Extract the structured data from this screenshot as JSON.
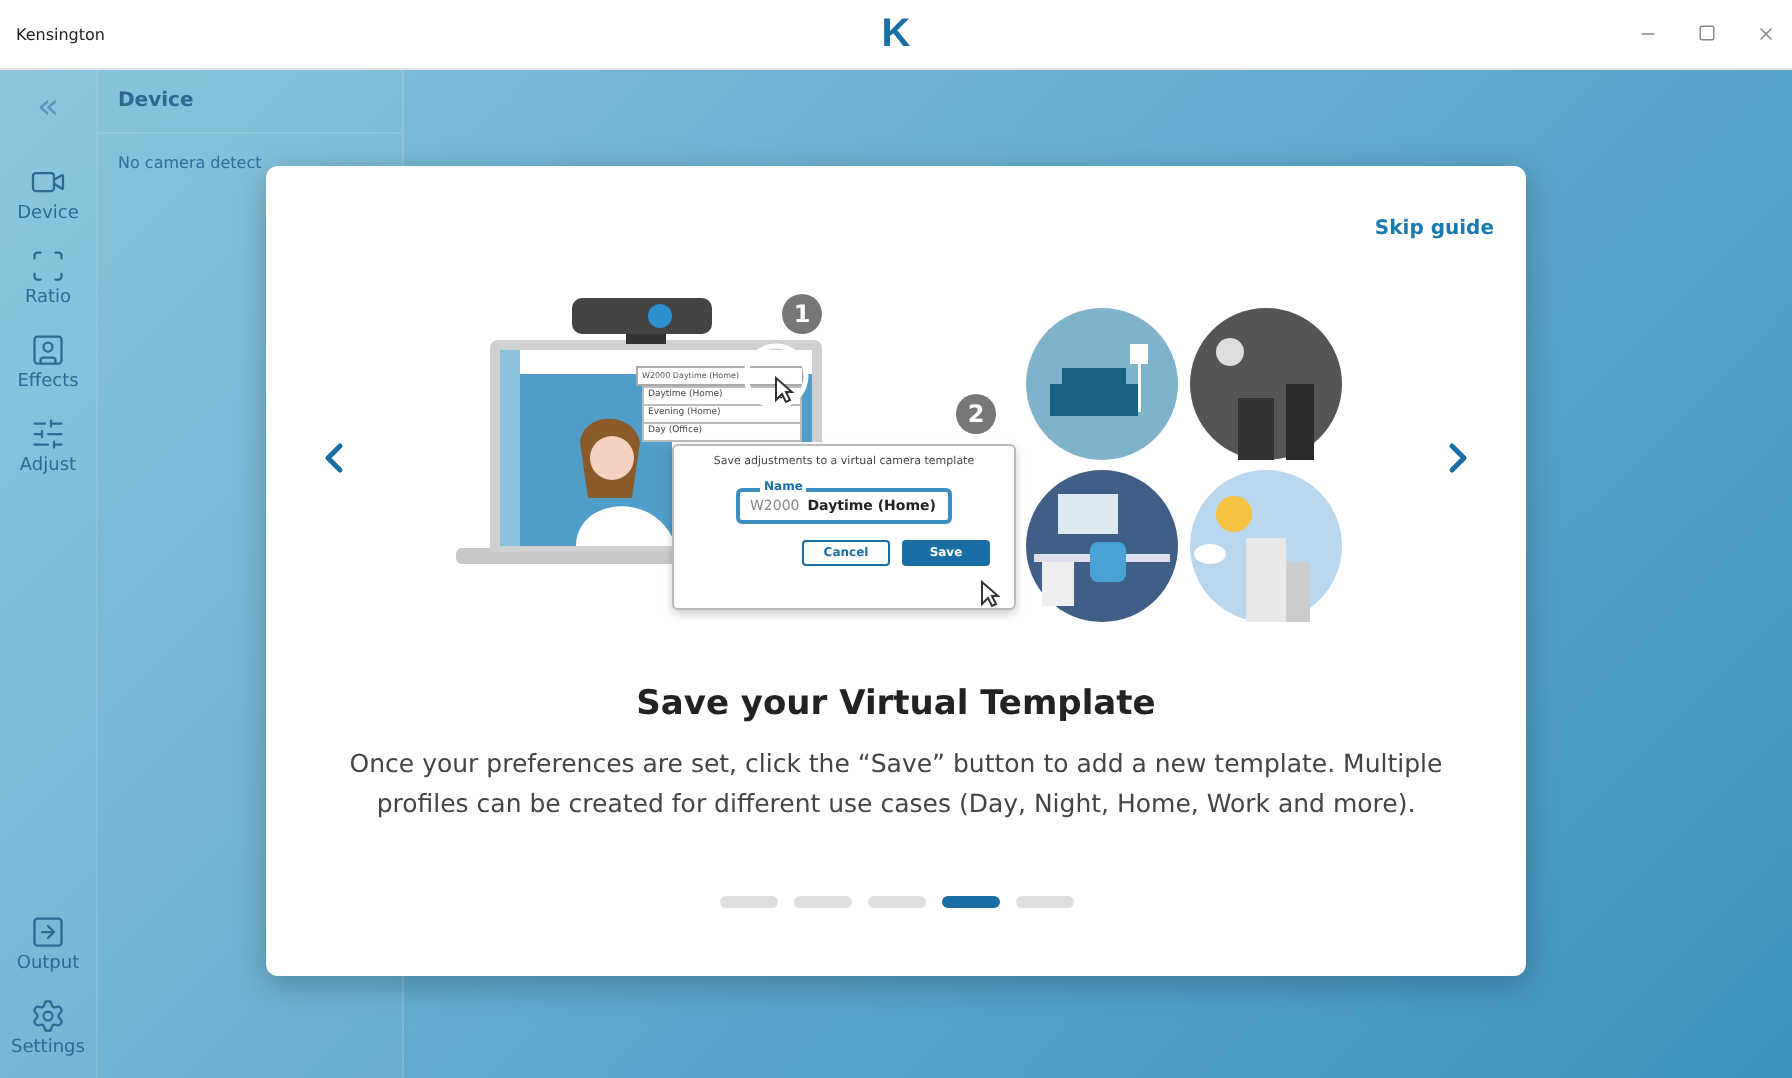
{
  "window": {
    "title": "Kensington",
    "logo": "K"
  },
  "sidebar": {
    "collapse": "«",
    "items": [
      {
        "kind": "camera",
        "label": "Device"
      },
      {
        "kind": "ratio",
        "label": "Ratio"
      },
      {
        "kind": "effects",
        "label": "Effects"
      },
      {
        "kind": "adjust",
        "label": "Adjust"
      }
    ],
    "bottom_items": [
      {
        "kind": "output",
        "label": "Output"
      },
      {
        "kind": "settings",
        "label": "Settings"
      }
    ]
  },
  "panel": {
    "title": "Device",
    "message": "No camera detect"
  },
  "guide": {
    "skip": "Skip guide",
    "illustration": {
      "steps": [
        "1",
        "2"
      ],
      "selector": "W2000 Daytime (Home)",
      "menu": [
        "Daytime (Home)",
        "Evening (Home)",
        "Day (Office)"
      ],
      "dialog": {
        "prompt": "Save adjustments to a virtual camera template",
        "field_label": "Name",
        "prefix": "W2000",
        "value": "Daytime (Home)",
        "cancel": "Cancel",
        "save": "Save"
      }
    },
    "title": "Save your Virtual Template",
    "body": "Once your preferences are set, click the “Save” button to add a new template. Multiple profiles can be created for different use cases (Day, Night, Home, Work and more).",
    "pages": [
      {
        "selected": false
      },
      {
        "selected": false
      },
      {
        "selected": false
      },
      {
        "selected": true
      },
      {
        "selected": false
      }
    ]
  }
}
